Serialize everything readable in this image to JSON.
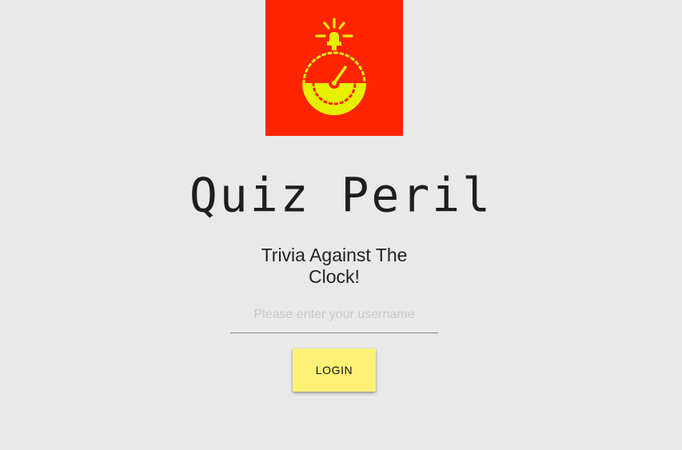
{
  "logo": {
    "icon": "stopwatch-alarm-icon",
    "background_color": "#ff2400",
    "icon_color": "#e6f000"
  },
  "app": {
    "title": "Quiz Peril",
    "subtitle": "Trivia Against The Clock!"
  },
  "login_form": {
    "username_placeholder": "Please enter your username",
    "username_value": "",
    "login_label": "LOGIN",
    "button_color": "#fff176"
  },
  "colors": {
    "page_background": "#e9e9e9",
    "text": "#1e1e1e"
  }
}
